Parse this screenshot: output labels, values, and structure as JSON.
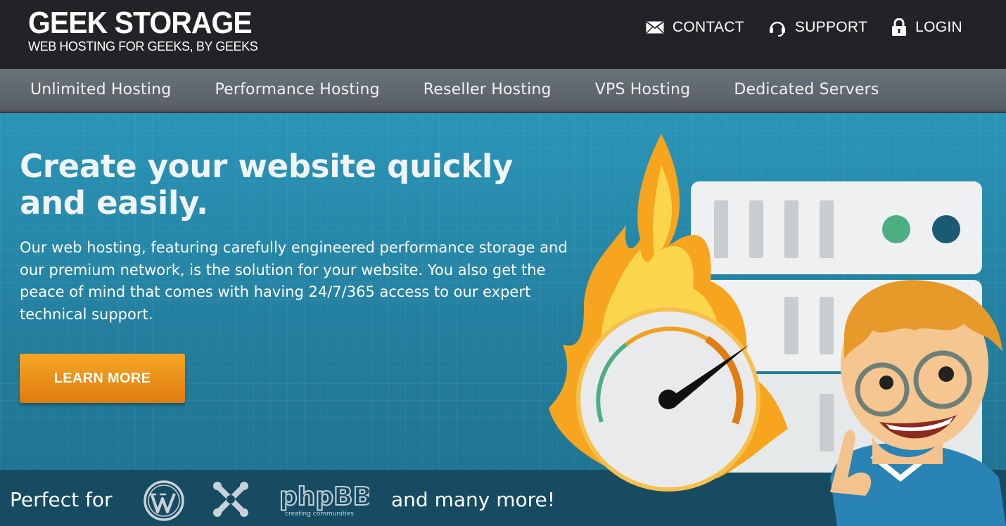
{
  "header": {
    "logo_title": "GEEK STORAGE",
    "logo_tagline": "WEB HOSTING FOR GEEKS, BY GEEKS",
    "links": [
      {
        "label": "CONTACT",
        "icon": "envelope-icon"
      },
      {
        "label": "SUPPORT",
        "icon": "headset-icon"
      },
      {
        "label": "LOGIN",
        "icon": "lock-icon"
      }
    ]
  },
  "nav": {
    "items": [
      "Unlimited Hosting",
      "Performance Hosting",
      "Reseller Hosting",
      "VPS Hosting",
      "Dedicated Servers"
    ]
  },
  "hero": {
    "headline": "Create your website quickly and easily.",
    "description": "Our web hosting, featuring carefully engineered performance storage and our premium network, is the solution for your website. You also get the peace of mind that comes with having 24/7/365 access to our expert technical support.",
    "cta_label": "LEARN MORE"
  },
  "strip": {
    "label": "Perfect for",
    "more": "and many more!",
    "logos": [
      "wordpress-logo",
      "joomla-logo",
      "phpbb-logo"
    ],
    "phpbb_text": "phpBB",
    "phpbb_tagline": "creating communities"
  },
  "colors": {
    "topbar": "#222326",
    "nav": "#5f676d",
    "hero": "#2a95b8",
    "strip": "#164b61",
    "cta": "#ee9419"
  }
}
